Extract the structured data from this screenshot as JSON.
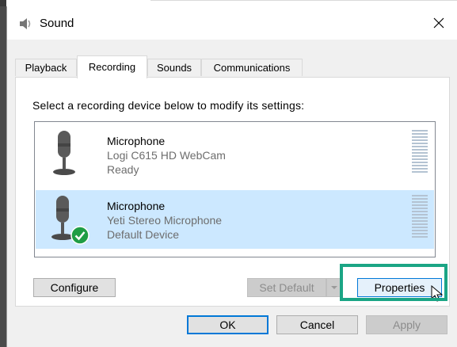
{
  "window": {
    "title": "Sound",
    "close_icon": "close-icon"
  },
  "tabs": [
    {
      "label": "Playback",
      "active": false
    },
    {
      "label": "Recording",
      "active": true
    },
    {
      "label": "Sounds",
      "active": false
    },
    {
      "label": "Communications",
      "active": false
    }
  ],
  "instruction": "Select a recording device below to modify its settings:",
  "devices": [
    {
      "name": "Microphone",
      "description": "Logi C615 HD WebCam",
      "status": "Ready",
      "selected": false,
      "icon": "microphone-icon"
    },
    {
      "name": "Microphone",
      "description": "Yeti Stereo Microphone",
      "status": "Default Device",
      "selected": true,
      "icon": "microphone-icon",
      "badge_icon": "default-check-icon"
    }
  ],
  "buttons": {
    "configure": "Configure",
    "set_default": "Set Default",
    "properties": "Properties",
    "ok": "OK",
    "cancel": "Cancel",
    "apply": "Apply"
  },
  "colors": {
    "selection": "#cce8ff",
    "highlight": "#1ba585",
    "default_button_border": "#0078d7",
    "check_badge": "#1f9d45"
  }
}
